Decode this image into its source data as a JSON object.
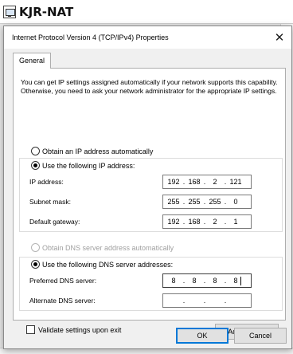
{
  "parent_window": {
    "title": "KJR-NAT"
  },
  "dialog": {
    "title": "Internet Protocol Version 4 (TCP/IPv4) Properties",
    "close_glyph": "✕",
    "tabs": [
      {
        "label": "General"
      }
    ],
    "intro_text": "You can get IP settings assigned automatically if your network supports this capability. Otherwise, you need to ask your network administrator for the appropriate IP settings.",
    "ip_options": {
      "auto_label": "Obtain an IP address automatically",
      "manual_label": "Use the following IP address:",
      "selected": "manual"
    },
    "ip_fields": [
      {
        "label": "IP address:",
        "octets": [
          "192",
          "168",
          "2",
          "121"
        ]
      },
      {
        "label": "Subnet mask:",
        "octets": [
          "255",
          "255",
          "255",
          "0"
        ]
      },
      {
        "label": "Default gateway:",
        "octets": [
          "192",
          "168",
          "2",
          "1"
        ]
      }
    ],
    "dns_options": {
      "auto_label": "Obtain DNS server address automatically",
      "manual_label": "Use the following DNS server addresses:",
      "selected": "manual",
      "auto_disabled": true
    },
    "dns_fields": [
      {
        "label": "Preferred DNS server:",
        "octets": [
          "8",
          "8",
          "8",
          "8"
        ]
      },
      {
        "label": "Alternate DNS server:",
        "octets": [
          "",
          "",
          "",
          ""
        ]
      }
    ],
    "validate_label": "Validate settings upon exit",
    "validate_checked": false,
    "advanced_label": "Advanced...",
    "ok_label": "OK",
    "cancel_label": "Cancel",
    "accent_color": "#0078d7"
  }
}
